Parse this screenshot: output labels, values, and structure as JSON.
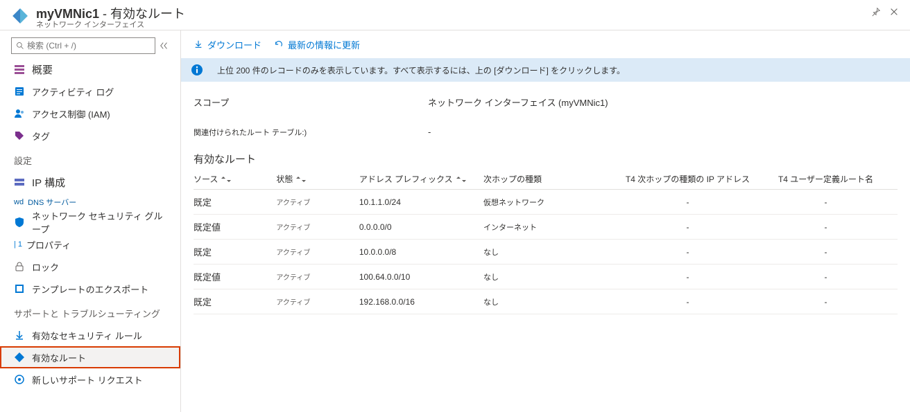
{
  "header": {
    "title_name": "myVMNic1",
    "title_sep": " - ",
    "title_page": "有効なルート",
    "subtitle": "ネットワーク インターフェイス"
  },
  "sidebar": {
    "search_placeholder": "検索 (Ctrl + /)",
    "items": {
      "overview": "概要",
      "activity": "アクティビティ ログ",
      "iam": "アクセス制御 (IAM)",
      "tags": "タグ"
    },
    "sections": {
      "settings": {
        "label": "設定",
        "items": {
          "ip_config": "IP 構成",
          "dns_prefix": "wd",
          "dns": "DNS サーバー",
          "nsg": "ネットワーク セキュリティ グループ",
          "props_prefix": "| 1",
          "props": "プロパティ",
          "lock": "ロック",
          "export": "テンプレートのエクスポート"
        }
      },
      "support": {
        "label": "サポートと トラブルシューティング",
        "items": {
          "sec_rules": "有効なセキュリティ ルール",
          "eff_routes": "有効なルート",
          "new_support": "新しいサポート リクエスト"
        }
      }
    }
  },
  "toolbar": {
    "download": "ダウンロード",
    "refresh": "最新の情報に更新"
  },
  "info": "上位 200 件のレコードのみを表示しています。すべて表示するには、上の [ダウンロード] をクリックします。",
  "meta": {
    "scope_label": "スコープ",
    "scope_value": "ネットワーク インターフェイス (myVMNic1)",
    "assoc_label": "関連付けられたルート テーブル:)",
    "assoc_value": "-"
  },
  "table": {
    "title": "有効なルート",
    "headers": {
      "source": "ソース",
      "state": "状態",
      "prefix": "アドレス プレフィックス",
      "nexthop_type": "次ホップの種類",
      "nexthop_ip": "T4 次ホップの種類の IP アドレス",
      "udr_name": "T4 ユーザー定義ルート名"
    },
    "rows": [
      {
        "source": "既定",
        "state": "アクティブ",
        "prefix": "10.1.1.0/24",
        "nexthop": "仮想ネットワーク",
        "ip": "-",
        "udr": "-"
      },
      {
        "source": "既定値",
        "state": "アクティブ",
        "prefix": "0.0.0.0/0",
        "nexthop": "インターネット",
        "ip": "-",
        "udr": "-"
      },
      {
        "source": "既定",
        "state": "アクティブ",
        "prefix": "10.0.0.0/8",
        "nexthop": "なし",
        "ip": "-",
        "udr": "-"
      },
      {
        "source": "既定値",
        "state": "アクティブ",
        "prefix": "100.64.0.0/10",
        "nexthop": "なし",
        "ip": "-",
        "udr": "-"
      },
      {
        "source": "既定",
        "state": "アクティブ",
        "prefix": "192.168.0.0/16",
        "nexthop": "なし",
        "ip": "-",
        "udr": "-"
      }
    ]
  }
}
